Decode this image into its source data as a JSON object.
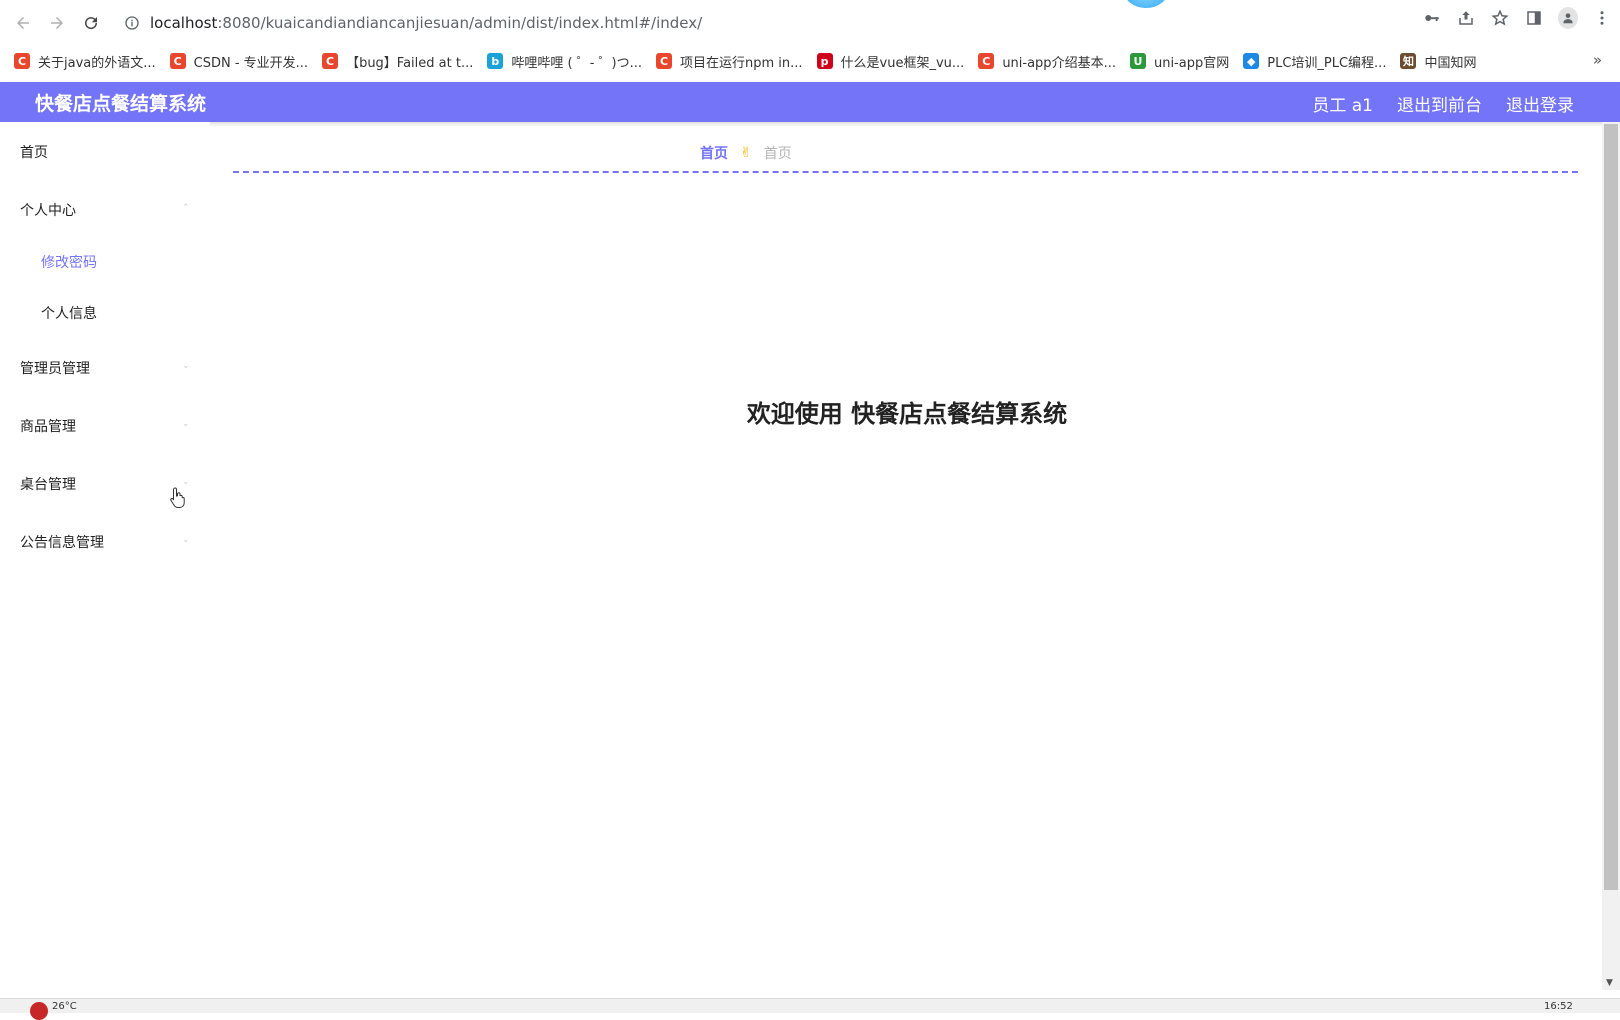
{
  "browser": {
    "url_host": "localhost",
    "url_rest": ":8080/kuaicandiandiancanjiesuan/admin/dist/index.html#/index/",
    "bookmarks": [
      {
        "label": "关于java的外语文...",
        "icon_color": "#e8472d",
        "icon_glyph": "C"
      },
      {
        "label": "CSDN - 专业开发...",
        "icon_color": "#e8472d",
        "icon_glyph": "C"
      },
      {
        "label": "【bug】Failed at t...",
        "icon_color": "#e8472d",
        "icon_glyph": "C"
      },
      {
        "label": "哔哩哔哩 ( ゜- ゜)つ...",
        "icon_color": "#1aa3d6",
        "icon_glyph": "b"
      },
      {
        "label": "项目在运行npm in...",
        "icon_color": "#e8472d",
        "icon_glyph": "C"
      },
      {
        "label": "什么是vue框架_vu...",
        "icon_color": "#d0021b",
        "icon_glyph": "p"
      },
      {
        "label": "uni-app介绍基本...",
        "icon_color": "#e8472d",
        "icon_glyph": "C"
      },
      {
        "label": "uni-app官网",
        "icon_color": "#2b9939",
        "icon_glyph": "U"
      },
      {
        "label": "PLC培训_PLC编程...",
        "icon_color": "#1e88e5",
        "icon_glyph": "◆"
      },
      {
        "label": "中国知网",
        "icon_color": "#6d4c2f",
        "icon_glyph": "知"
      }
    ],
    "more": "»"
  },
  "header": {
    "title": "快餐店点餐结算系统",
    "user": "员工 a1",
    "front": "退出到前台",
    "logout": "退出登录",
    "accent": "#7474f8"
  },
  "sidebar": {
    "home": "首页",
    "personal_center": "个人中心",
    "change_password": "修改密码",
    "personal_info": "个人信息",
    "admin_manage": "管理员管理",
    "goods_manage": "商品管理",
    "table_manage": "桌台管理",
    "notice_manage": "公告信息管理"
  },
  "breadcrumb": {
    "first": "首页",
    "separator": "✌",
    "second": "首页"
  },
  "main": {
    "welcome_prefix": "欢迎使用",
    "welcome_system": "快餐店点餐结算系统"
  },
  "taskbar": {
    "left_text": "26°C",
    "clock": "16:52"
  }
}
